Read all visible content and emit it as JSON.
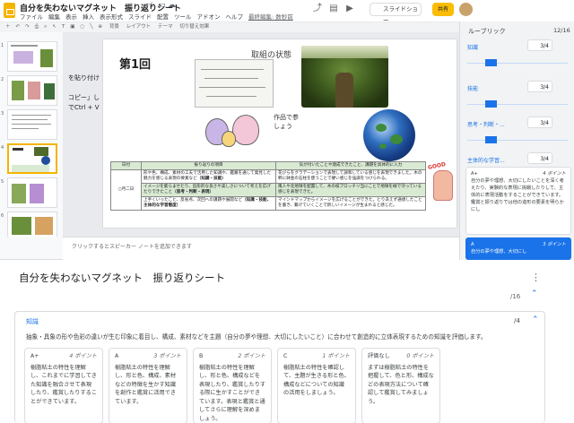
{
  "doc": {
    "title": "自分を失わないマグネット　振り返りシート",
    "menu": [
      "ファイル",
      "編集",
      "表示",
      "挿入",
      "表示形式",
      "スライド",
      "配置",
      "ツール",
      "アドオン",
      "ヘルプ"
    ],
    "last_edit": "最終編集: 数秒前",
    "slideshow_label": "スライドショー",
    "share_label": "共有"
  },
  "toolbar": {
    "items": [
      "背景",
      "レイアウト",
      "テーマ",
      "切り替え効果"
    ]
  },
  "thumbs": {
    "numbers": [
      "1",
      "2",
      "3",
      "4",
      "5",
      "6"
    ]
  },
  "slide": {
    "title": "第1回",
    "subtitle": "取組の状態",
    "paste_hint": [
      "を貼り付け",
      "",
      "コピー」し",
      "でCtrl + V"
    ],
    "caption_lines": [
      "作品で参",
      "しょう"
    ],
    "good": "GOOD",
    "table": {
      "headers": [
        "日付",
        "振り返りの項目",
        "気が付いたことや達成できたこと、課題を具体的に入力"
      ],
      "date": "○月二日",
      "rows": [
        {
          "item": "形や色、構成、素材の工夫で活用した知識や、鑑賞を通して発見した魅力を感じる表現の要素など",
          "tag": "（知識・技能）",
          "note": "花びらをグラデーションで表現して調和している感じを表現できました。木の幹に鉢金の石柱を使うことで硬い感じを強調をつけられる。"
        },
        {
          "item": "イメージを膨らませたり、追形的な良さや美しさについて考えを広げたりできたこと",
          "tag": "（思考・判断・表現）",
          "note": "風人や北地球を配置して、木の枝ブロッチリ当にことで地球を緑で守っている感じを表現できた。"
        },
        {
          "item": "上手くいったこと、反省点、次回への課題や展開など",
          "tag": "（知識・技能、主体的な学習態度）",
          "note": "マインドマップからイメージを広げることができた。とりあえず通想したことを書き、繋げていくことで新しいイメージが生まれると感じた。"
        }
      ]
    }
  },
  "notes": {
    "placeholder": "クリックするとスピーカー ノートを追加できます"
  },
  "rubric": {
    "title": "ルーブリック",
    "count": "12/16",
    "criteria": [
      {
        "name": "知識",
        "score": "3/4",
        "bar_level": 0.5
      },
      {
        "name": "技能",
        "score": "3/4",
        "bar_level": 0.5
      },
      {
        "name": "思考・判断・...",
        "score": "3/4",
        "bar_level": 0.5
      },
      {
        "name": "主体的な学習...",
        "score": "3/4",
        "bar_level": 0.5
      }
    ],
    "card_a": {
      "grade": "A+",
      "points": "4 ポイント",
      "text": "自分の夢や理想、大切にしたいことを深く考えたり、実験的な表現に挑戦したりして、主体的に表現活動をすることができています。鑑賞と振り返りでは他の造形の要素を明らかにし"
    },
    "card_sel": {
      "grade": "A",
      "points": "3 ポイント",
      "text": "自分の夢や理想、大切にし"
    }
  },
  "bottom": {
    "title": "自分を失わないマグネット　振り返りシート",
    "total": "/16",
    "criterion": {
      "name": "知識",
      "score": "/4",
      "description": "抽象・具象の形や色彩の違いが生む印象に着目し、構成、素材などを主題（自分の夢や理想、大切にしたいこと）に合わせて創造的に立体表現するための知識を評価します。",
      "levels": [
        {
          "grade": "A+",
          "points": "4 ポイント",
          "text": "樹脂粘土の特性を理解し、これまでに学習してきた知識を融合させて表現したり、鑑賞したりすることができています。"
        },
        {
          "grade": "A",
          "points": "3 ポイント",
          "text": "樹脂粘土の特性を理解し、形と色、構成、素材などの特徴を生かす知識を創作と鑑賞に活用できています。"
        },
        {
          "grade": "B",
          "points": "2 ポイント",
          "text": "樹脂粘土の特性を理解し、形と色、構成などを表現したり、鑑賞したりする際に生かすことができています。表現と鑑賞と通してさらに理解を深めましょう。"
        },
        {
          "grade": "C",
          "points": "1 ポイント",
          "text": "樹脂粘土の特性を確認して、主題が生きる形と色、構成などについての知識の活用をしましょう。"
        },
        {
          "grade": "評価なし",
          "points": "0 ポイント",
          "text": "まずは樹脂粘土の特性を把握して、色と形、構成などの表現方法について確認して鑑賞してみましょう。"
        }
      ]
    }
  }
}
